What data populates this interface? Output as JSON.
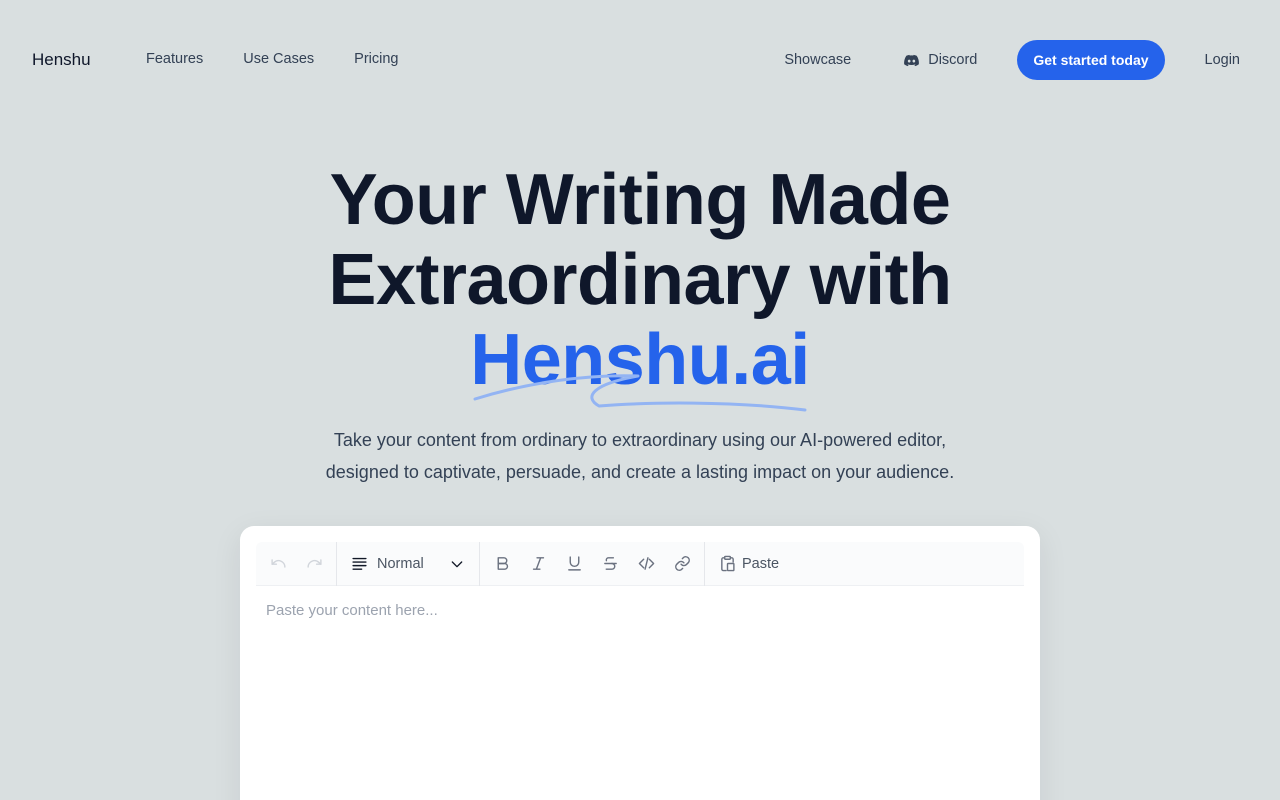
{
  "nav": {
    "logo": "Henshu",
    "links": [
      "Features",
      "Use Cases",
      "Pricing"
    ],
    "showcase": "Showcase",
    "discord": "Discord",
    "cta": "Get started today",
    "login": "Login"
  },
  "hero": {
    "line1": "Your Writing Made",
    "line2": "Extraordinary with",
    "accent": "Henshu.ai",
    "sub1": "Take your content from ordinary to extraordinary using our AI-powered editor,",
    "sub2": "designed to captivate, persuade, and create a lasting impact on your audience."
  },
  "editor": {
    "block_type": "Normal",
    "paste_label": "Paste",
    "placeholder": "Paste your content here...",
    "icons": [
      "undo-icon",
      "redo-icon",
      "text-align-icon",
      "chevron-down-icon",
      "bold-icon",
      "italic-icon",
      "underline-icon",
      "strikethrough-icon",
      "code-icon",
      "link-icon",
      "clipboard-icon"
    ]
  },
  "colors": {
    "accent": "#2563eb",
    "background": "#d9dfe0",
    "heading": "#0f172a",
    "squiggle": "#93b4f3"
  }
}
